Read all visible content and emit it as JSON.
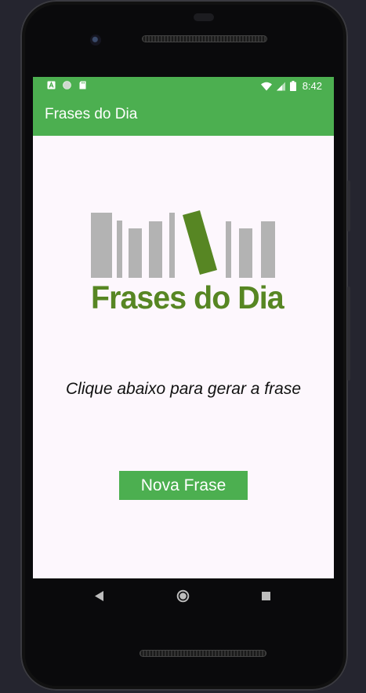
{
  "status_bar": {
    "time": "8:42"
  },
  "app_bar": {
    "title": "Frases do Dia"
  },
  "logo": {
    "text": "Frases do Dia"
  },
  "main": {
    "prompt": "Clique abaixo para gerar a frase",
    "button_label": "Nova Frase"
  },
  "colors": {
    "accent": "#4caf50",
    "logo_green": "#578623",
    "logo_gray": "#b3b3b3",
    "screen_bg": "#fdf7fd"
  },
  "icons": {
    "status_left": [
      "accessibility-icon",
      "circle-icon",
      "sd-card-icon"
    ],
    "status_right": [
      "wifi-icon",
      "signal-icon",
      "battery-icon"
    ],
    "nav": [
      "back-icon",
      "home-icon",
      "recents-icon"
    ]
  }
}
